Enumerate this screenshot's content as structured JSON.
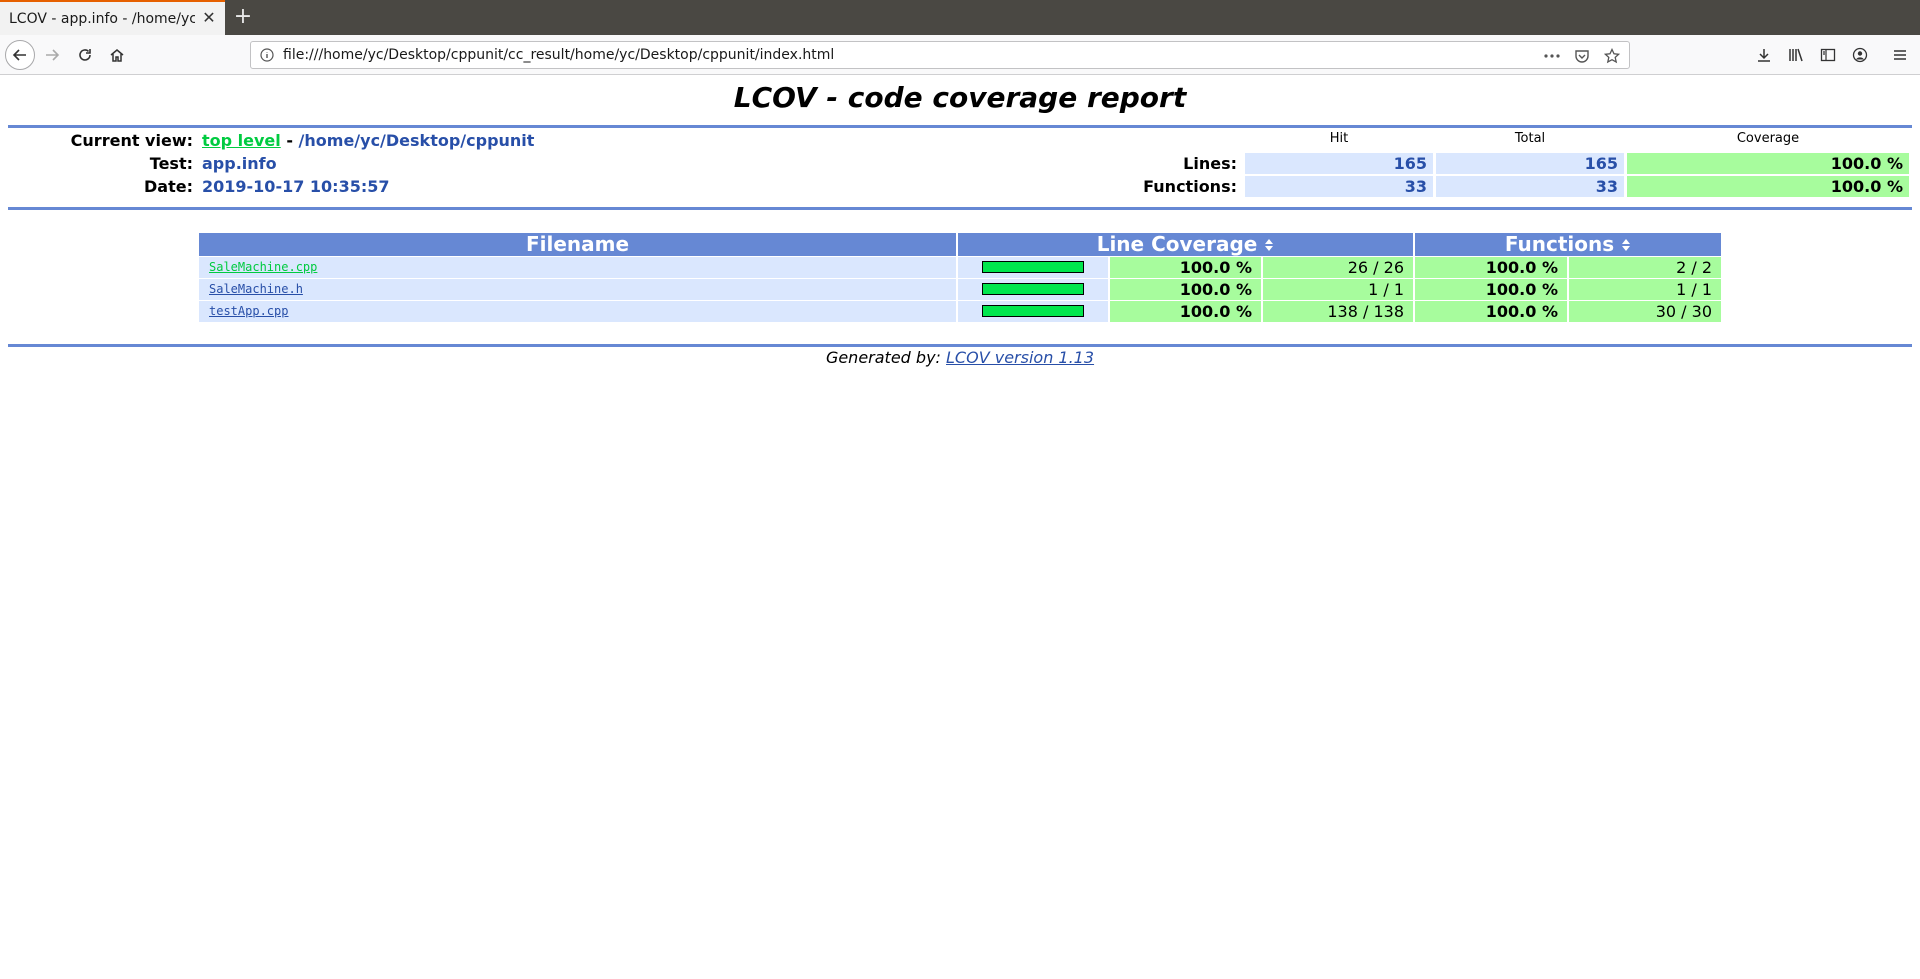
{
  "browser": {
    "tab_title": "LCOV - app.info - /home/yc/",
    "url": "file:///home/yc/Desktop/cppunit/cc_result/home/yc/Desktop/cppunit/index.html"
  },
  "report": {
    "title": "LCOV - code coverage report",
    "header": {
      "current_view_label": "Current view:",
      "top_level_link": "top level",
      "separator": " - ",
      "path": "/home/yc/Desktop/cppunit",
      "test_label": "Test:",
      "test_value": "app.info",
      "date_label": "Date:",
      "date_value": "2019-10-17 10:35:57"
    },
    "summary": {
      "columns": [
        "Hit",
        "Total",
        "Coverage"
      ],
      "rows": [
        {
          "label": "Lines:",
          "hit": "165",
          "total": "165",
          "coverage": "100.0 %"
        },
        {
          "label": "Functions:",
          "hit": "33",
          "total": "33",
          "coverage": "100.0 %"
        }
      ]
    },
    "table": {
      "headers": [
        "Filename",
        "Line Coverage",
        "Functions"
      ],
      "rows": [
        {
          "filename": "SaleMachine.cpp",
          "link_color": "#00cb40",
          "line_pct": "100.0 %",
          "line_ratio": "26 / 26",
          "line_fill": 1.0,
          "func_pct": "100.0 %",
          "func_ratio": "2 / 2"
        },
        {
          "filename": "SaleMachine.h",
          "link_color": "#284fa8",
          "line_pct": "100.0 %",
          "line_ratio": "1 / 1",
          "line_fill": 1.0,
          "func_pct": "100.0 %",
          "func_ratio": "1 / 1"
        },
        {
          "filename": "testApp.cpp",
          "link_color": "#284fa8",
          "line_pct": "100.0 %",
          "line_ratio": "138 / 138",
          "line_fill": 1.0,
          "func_pct": "100.0 %",
          "func_ratio": "30 / 30"
        }
      ]
    },
    "footer": {
      "prefix": "Generated by: ",
      "link": "LCOV version 1.13"
    }
  },
  "colors": {
    "header_blue": "#6688d4",
    "cell_blue": "#dae7fe",
    "cell_green": "#a7fc9d",
    "bar_green": "#00e64d",
    "value_blue": "#284fa8"
  }
}
